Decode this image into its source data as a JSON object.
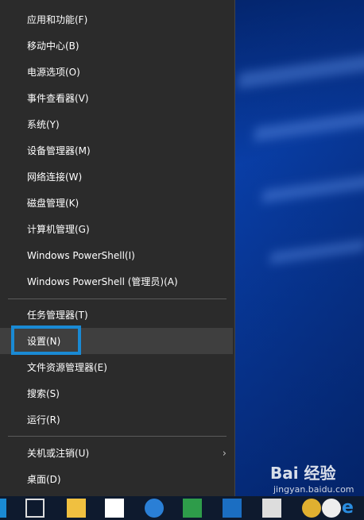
{
  "menu": {
    "items": [
      {
        "label": "应用和功能(F)"
      },
      {
        "label": "移动中心(B)"
      },
      {
        "label": "电源选项(O)"
      },
      {
        "label": "事件查看器(V)"
      },
      {
        "label": "系统(Y)"
      },
      {
        "label": "设备管理器(M)"
      },
      {
        "label": "网络连接(W)"
      },
      {
        "label": "磁盘管理(K)"
      },
      {
        "label": "计算机管理(G)"
      },
      {
        "label": "Windows PowerShell(I)"
      },
      {
        "label": "Windows PowerShell (管理员)(A)"
      },
      {
        "label": "任务管理器(T)"
      },
      {
        "label": "设置(N)"
      },
      {
        "label": "文件资源管理器(E)"
      },
      {
        "label": "搜索(S)"
      },
      {
        "label": "运行(R)"
      },
      {
        "label": "关机或注销(U)"
      },
      {
        "label": "桌面(D)"
      }
    ],
    "active_item": "设置(N)",
    "submenu_arrow": "›"
  },
  "watermark": {
    "text": "Bai 经验",
    "sub": "jingyan.baidu.com"
  },
  "taskbar": {
    "icons": [
      "task-view-icon",
      "file-explorer-icon",
      "store-icon",
      "app-icon",
      "app-icon",
      "outlook-icon",
      "calculator-icon",
      "chrome-icon",
      "qq-icon",
      "edge-icon"
    ]
  },
  "colors": {
    "menu_bg": "#2b2b2b",
    "highlight": "#1a8ad4",
    "active_bg": "#3f3f3f"
  }
}
